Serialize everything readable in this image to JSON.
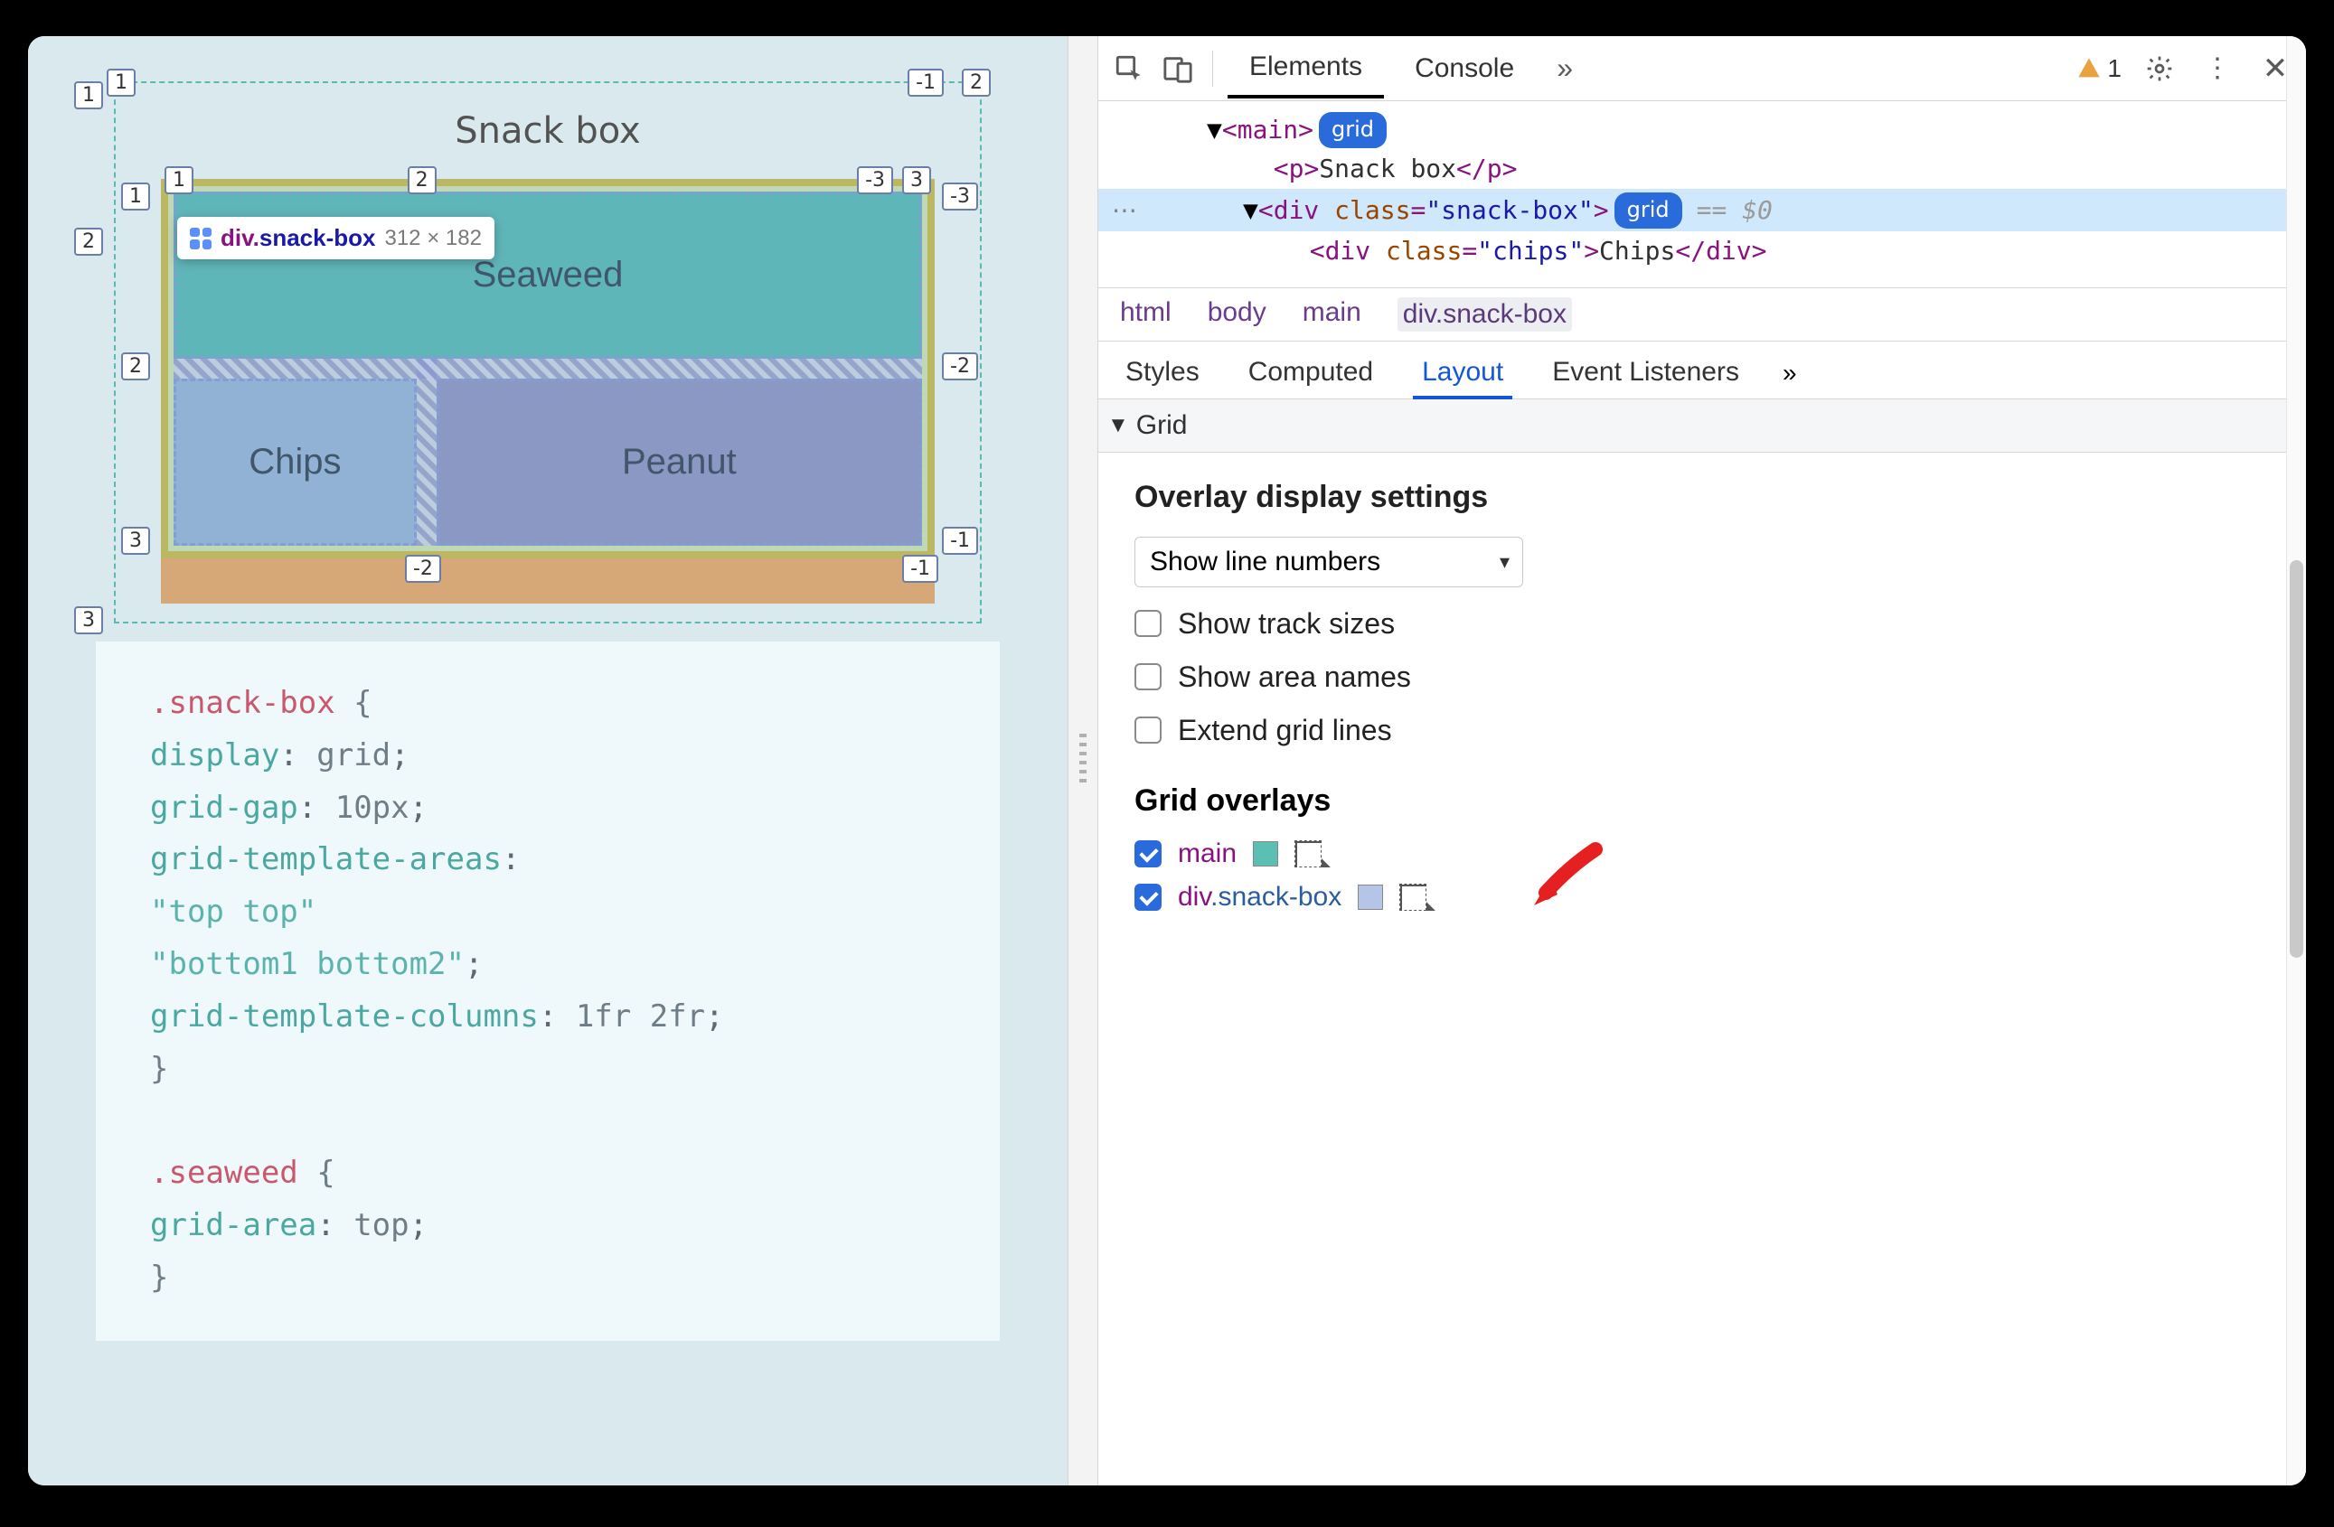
{
  "viewport": {
    "tooltip": {
      "tag": "div",
      "class": "snack-box",
      "dims": "312 × 182"
    },
    "page_title": "Snack box",
    "cells": {
      "seaweed": "Seaweed",
      "chips": "Chips",
      "peanut": "Peanut"
    },
    "gridlines_outer": {
      "top_left": "1",
      "top_right_neg": "-1",
      "top_right_next": "2",
      "row2_left": "2",
      "row3_left": "3"
    },
    "gridlines_inner": {
      "col1": "1",
      "col2": "2",
      "col3": "3",
      "col3n": "-3",
      "row1": "1",
      "row2": "2",
      "row3": "3",
      "neg1": "-1",
      "neg2": "-2",
      "neg1b": "-1",
      "neg2b": "-2",
      "neg3": "-3"
    },
    "code": {
      "l1a": ".snack-box",
      "l1b": " {",
      "l2p": "display",
      "l2v": "grid",
      "l3p": "grid-gap",
      "l3v": "10px",
      "l4p": "grid-template-areas",
      "l5v": "\"top top\"",
      "l6v": "\"bottom1 bottom2\"",
      "l7p": "grid-template-columns",
      "l7v": "1fr 2fr",
      "l8": "}",
      "l10a": ".seaweed",
      "l10b": " {",
      "l11p": "grid-area",
      "l11v": "top",
      "l12": "}"
    }
  },
  "devtools": {
    "tabs": {
      "elements": "Elements",
      "console": "Console"
    },
    "warning_count": "1",
    "dom": {
      "main_open": "<main>",
      "main_badge": "grid",
      "p_line": "<p>Snack box</p>",
      "div_open_pre": "<div ",
      "div_attr": "class",
      "div_val": "\"snack-box\"",
      "div_close": ">",
      "div_badge": "grid",
      "div_suffix": "== $0",
      "chips_pre": "<div ",
      "chips_attr": "class",
      "chips_val": "\"chips\"",
      "chips_mid": ">",
      "chips_text": "Chips",
      "chips_end": "</div>"
    },
    "breadcrumbs": [
      "html",
      "body",
      "main",
      "div.snack-box"
    ],
    "styles_tabs": [
      "Styles",
      "Computed",
      "Layout",
      "Event Listeners"
    ],
    "grid_section": "Grid",
    "overlay_settings_title": "Overlay display settings",
    "select_value": "Show line numbers",
    "checks": {
      "track": "Show track sizes",
      "area": "Show area names",
      "extend": "Extend grid lines"
    },
    "grid_overlays_title": "Grid overlays",
    "overlays": [
      {
        "name": "main",
        "class": "",
        "checked": true,
        "swatch": "#5cbfb4"
      },
      {
        "name": "div",
        "class": ".snack-box",
        "checked": true,
        "swatch": "#b4c5e8"
      }
    ]
  }
}
